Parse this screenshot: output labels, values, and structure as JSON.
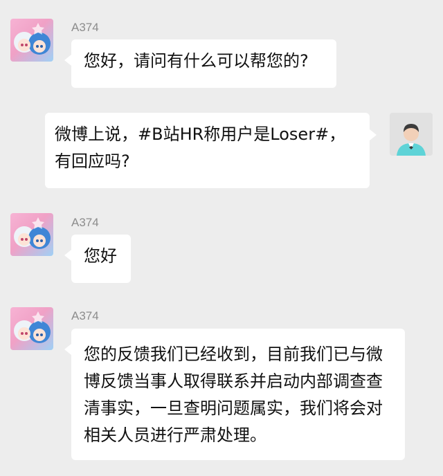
{
  "messages": [
    {
      "sender": "A374",
      "side": "left",
      "text": "您好，请问有什么可以帮您的?",
      "avatar_icon": "anime-twins-avatar-icon"
    },
    {
      "sender": "",
      "side": "right",
      "text": "微博上说，#B站HR称用户是Loser#，有回应吗?",
      "avatar_icon": "default-user-avatar-icon"
    },
    {
      "sender": "A374",
      "side": "left",
      "text": "您好",
      "avatar_icon": "anime-twins-avatar-icon"
    },
    {
      "sender": "A374",
      "side": "left",
      "text": "您的反馈我们已经收到，目前我们已与微博反馈当事人取得联系并启动内部调查查清事实，一旦查明问题属实，我们将会对相关人员进行严肃处理。",
      "avatar_icon": "anime-twins-avatar-icon"
    }
  ],
  "colors": {
    "background": "#ededed",
    "bubble": "#ffffff",
    "name_text": "#8c8c8c",
    "message_text": "#111111"
  }
}
